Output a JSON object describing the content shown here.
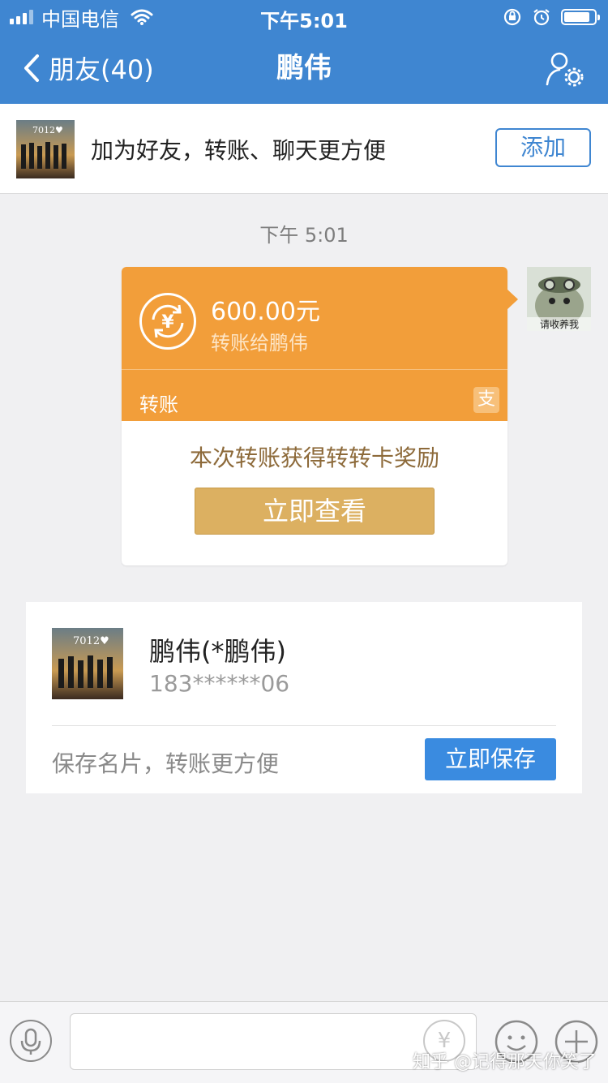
{
  "status_bar": {
    "carrier": "中国电信",
    "time": "下午5:01",
    "battery_level": 0.85
  },
  "nav": {
    "back_label": "朋友(40)",
    "title": "鹏伟"
  },
  "banner": {
    "text": "加为好友，转账、聊天更方便",
    "add_label": "添加",
    "avatar_caption": "7012♥"
  },
  "chat": {
    "timestamp": "下午 5:01",
    "sender_avatar_caption": "请收养我",
    "transfer": {
      "amount": "600.00元",
      "to": "转账给鹏伟",
      "label": "转账",
      "alipay_badge": "支",
      "coin_symbol": "¥",
      "reward_text": "本次转账获得转转卡奖励",
      "view_label": "立即查看"
    }
  },
  "contact": {
    "name": "鹏伟(*鹏伟)",
    "phone": "183******06",
    "avatar_caption": "7012♥",
    "save_hint": "保存名片，转账更方便",
    "save_label": "立即保存"
  },
  "input_bar": {
    "yen_symbol": "¥",
    "watermark": "知乎 @记得那天你笑了"
  },
  "colors": {
    "header_blue": "#3f86d1",
    "transfer_orange": "#f29e3a",
    "reward_gold": "#dcb061",
    "save_blue": "#3a8be0"
  }
}
